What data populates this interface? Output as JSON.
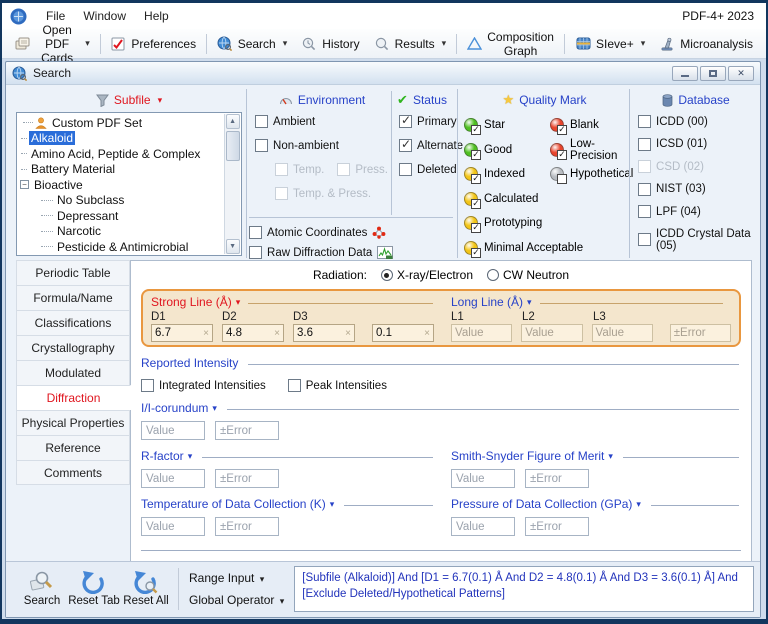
{
  "app": {
    "menu": [
      "File",
      "Window",
      "Help"
    ],
    "title": "PDF-4+ 2023"
  },
  "toolbar": {
    "open_pdf_cards": "Open PDF Cards",
    "preferences": "Preferences",
    "search": "Search",
    "history": "History",
    "results": "Results",
    "composition_graph": "Composition Graph",
    "sieve": "SIeve+",
    "microanalysis": "Microanalysis"
  },
  "window": {
    "title": "Search"
  },
  "subfile": {
    "header": "Subfile",
    "items": [
      {
        "label": "Custom PDF Set",
        "selected": false
      },
      {
        "label": "Alkaloid",
        "selected": true
      },
      {
        "label": "Amino Acid, Peptide & Complex",
        "selected": false
      },
      {
        "label": "Battery Material",
        "selected": false
      },
      {
        "label": "Bioactive",
        "selected": false
      },
      {
        "label": "No Subclass",
        "selected": false
      },
      {
        "label": "Depressant",
        "selected": false
      },
      {
        "label": "Narcotic",
        "selected": false
      },
      {
        "label": "Pesticide & Antimicrobial",
        "selected": false
      }
    ]
  },
  "environment": {
    "header": "Environment",
    "ambient": {
      "label": "Ambient",
      "checked": false
    },
    "non_ambient": {
      "label": "Non-ambient",
      "checked": false
    },
    "temp": {
      "label": "Temp.",
      "disabled": true
    },
    "press": {
      "label": "Press.",
      "disabled": true
    },
    "temp_press": {
      "label": "Temp. & Press.",
      "disabled": true
    },
    "atomic_coordinates": {
      "label": "Atomic Coordinates",
      "checked": false
    },
    "raw_diffraction": {
      "label": "Raw Diffraction Data",
      "checked": false
    }
  },
  "status": {
    "header": "Status",
    "items": [
      {
        "label": "Primary",
        "checked": true
      },
      {
        "label": "Alternate",
        "checked": true
      },
      {
        "label": "Deleted",
        "checked": false
      }
    ]
  },
  "quality_mark": {
    "header": "Quality Mark",
    "left": [
      {
        "label": "Star",
        "color": "#4fc021",
        "checked": true
      },
      {
        "label": "Good",
        "color": "#4fc021",
        "checked": true
      },
      {
        "label": "Indexed",
        "color": "#f3c515",
        "checked": true
      },
      {
        "label": "Calculated",
        "color": "#f3c515",
        "checked": true
      },
      {
        "label": "Prototyping",
        "color": "#f3c515",
        "checked": true
      },
      {
        "label": "Minimal Acceptable",
        "color": "#f3c515",
        "checked": true
      }
    ],
    "right": [
      {
        "label": "Blank",
        "color": "#e8442c",
        "checked": true
      },
      {
        "label": "Low-Precision",
        "color": "#e8442c",
        "checked": true
      },
      {
        "label": "Hypothetical",
        "color": "#b9bdc2",
        "checked": false
      }
    ]
  },
  "database": {
    "header": "Database",
    "items": [
      {
        "label": "ICDD (00)",
        "disabled": false
      },
      {
        "label": "ICSD (01)",
        "disabled": false
      },
      {
        "label": "CSD (02)",
        "disabled": true
      },
      {
        "label": "NIST (03)",
        "disabled": false
      },
      {
        "label": "LPF (04)",
        "disabled": false
      },
      {
        "label": "ICDD Crystal Data (05)",
        "disabled": false
      }
    ]
  },
  "tabs": {
    "items": [
      {
        "label": "Periodic Table",
        "selected": false
      },
      {
        "label": "Formula/Name",
        "selected": false
      },
      {
        "label": "Classifications",
        "selected": false
      },
      {
        "label": "Crystallography",
        "selected": false
      },
      {
        "label": "Modulated",
        "selected": false
      },
      {
        "label": "Diffraction",
        "selected": true
      },
      {
        "label": "Physical Properties",
        "selected": false
      },
      {
        "label": "Reference",
        "selected": false
      },
      {
        "label": "Comments",
        "selected": false
      }
    ]
  },
  "radiation": {
    "label": "Radiation:",
    "options": [
      {
        "label": "X-ray/Electron",
        "selected": true
      },
      {
        "label": "CW Neutron",
        "selected": false
      }
    ]
  },
  "strong_line": {
    "header": "Strong Line (Å)",
    "fields": [
      {
        "label": "D1",
        "value": "6.7"
      },
      {
        "label": "D2",
        "value": "4.8"
      },
      {
        "label": "D3",
        "value": "3.6"
      }
    ],
    "error": {
      "value": "0.1"
    }
  },
  "long_line": {
    "header": "Long Line (Å)",
    "fields": [
      {
        "label": "L1",
        "placeholder": "Value"
      },
      {
        "label": "L2",
        "placeholder": "Value"
      },
      {
        "label": "L3",
        "placeholder": "Value"
      }
    ],
    "error": {
      "placeholder": "±Error"
    }
  },
  "reported_intensity": {
    "header": "Reported Intensity",
    "integrated": {
      "label": "Integrated Intensities",
      "checked": false
    },
    "peak": {
      "label": "Peak Intensities",
      "checked": false
    }
  },
  "fields": {
    "value_placeholder": "Value",
    "error_placeholder": "±Error",
    "i_i_corundum": "I/I-corundum",
    "r_factor": "R-factor",
    "smith_snyder": "Smith-Snyder Figure of Merit",
    "temperature": "Temperature of Data Collection (K)",
    "pressure": "Pressure of Data Collection (GPa)"
  },
  "bottom": {
    "search": "Search",
    "reset_tab": "Reset Tab",
    "reset_all": "Reset All",
    "range_input": "Range Input",
    "global_operator": "Global Operator",
    "query": "[Subfile (Alkaloid)] And [D1 = 6.7(0.1) Å And D2 = 4.8(0.1) Å And D3 = 3.6(0.1) Å] And [Exclude Deleted/Hypothetical Patterns]"
  },
  "colors": {
    "accent_orange": "#e9973f",
    "header_blue": "#2742c8",
    "active_red": "#e0161f",
    "query_blue": "#2233bb",
    "selection_blue": "#2a6dd9"
  }
}
